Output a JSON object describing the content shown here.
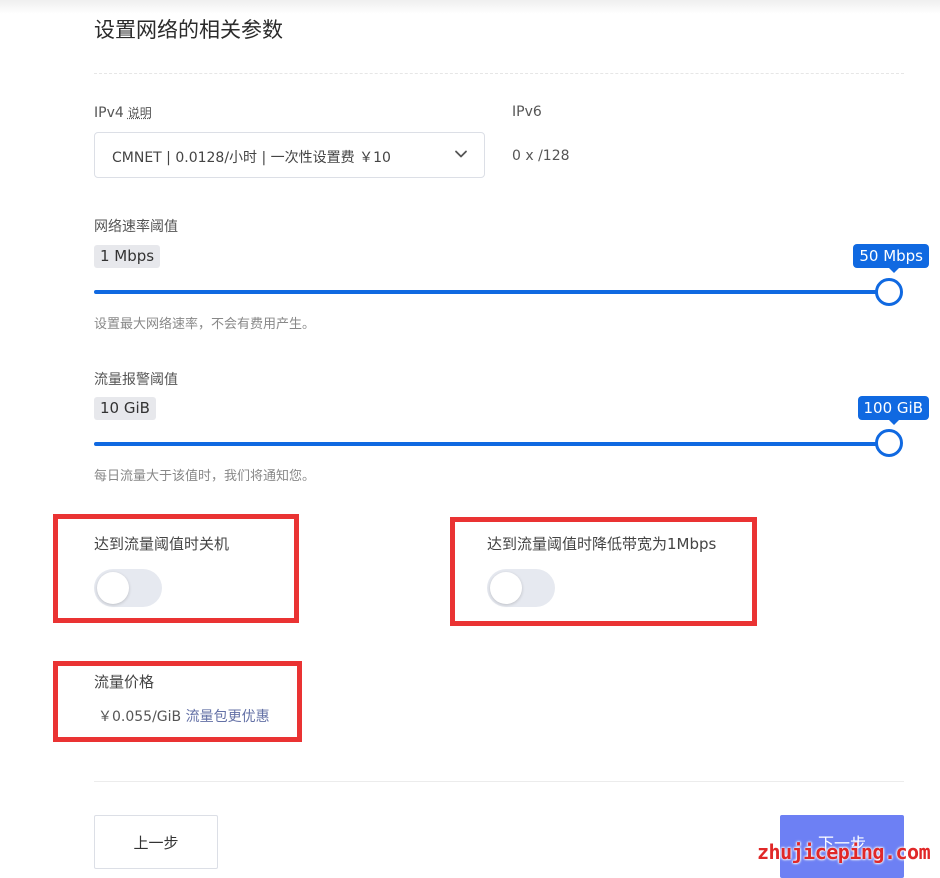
{
  "page": {
    "title": "设置网络的相关参数"
  },
  "ipv4": {
    "label": "IPv4",
    "help_link": "说明",
    "selected": "CMNET | 0.0128/小时 | 一次性设置费 ￥10"
  },
  "ipv6": {
    "label": "IPv6",
    "value": "0 x /128"
  },
  "bandwidth": {
    "label": "网络速率阈值",
    "min": "1 Mbps",
    "max": "50 Mbps",
    "level": 1.0,
    "hint": "设置最大网络速率，不会有费用产生。"
  },
  "traffic_alert": {
    "label": "流量报警阈值",
    "min": "10 GiB",
    "max": "100 GiB",
    "level": 1.0,
    "hint": "每日流量大于该值时，我们将通知您。"
  },
  "toggles": {
    "shutdown_label": "达到流量阈值时关机",
    "shutdown_on": false,
    "throttle_label": "达到流量阈值时降低带宽为1Mbps",
    "throttle_on": false
  },
  "traffic_price": {
    "label": "流量价格",
    "price": "￥0.055/GiB",
    "package_link": "流量包更优惠"
  },
  "footer": {
    "prev_label": "上一步",
    "next_label": "下一步"
  },
  "watermark": "zhujiceping.com",
  "colors": {
    "accent": "#1069e1",
    "primary_button": "#6d80f4",
    "highlight_box": "#ea3333",
    "toggle_off": "#e6e9f0"
  }
}
